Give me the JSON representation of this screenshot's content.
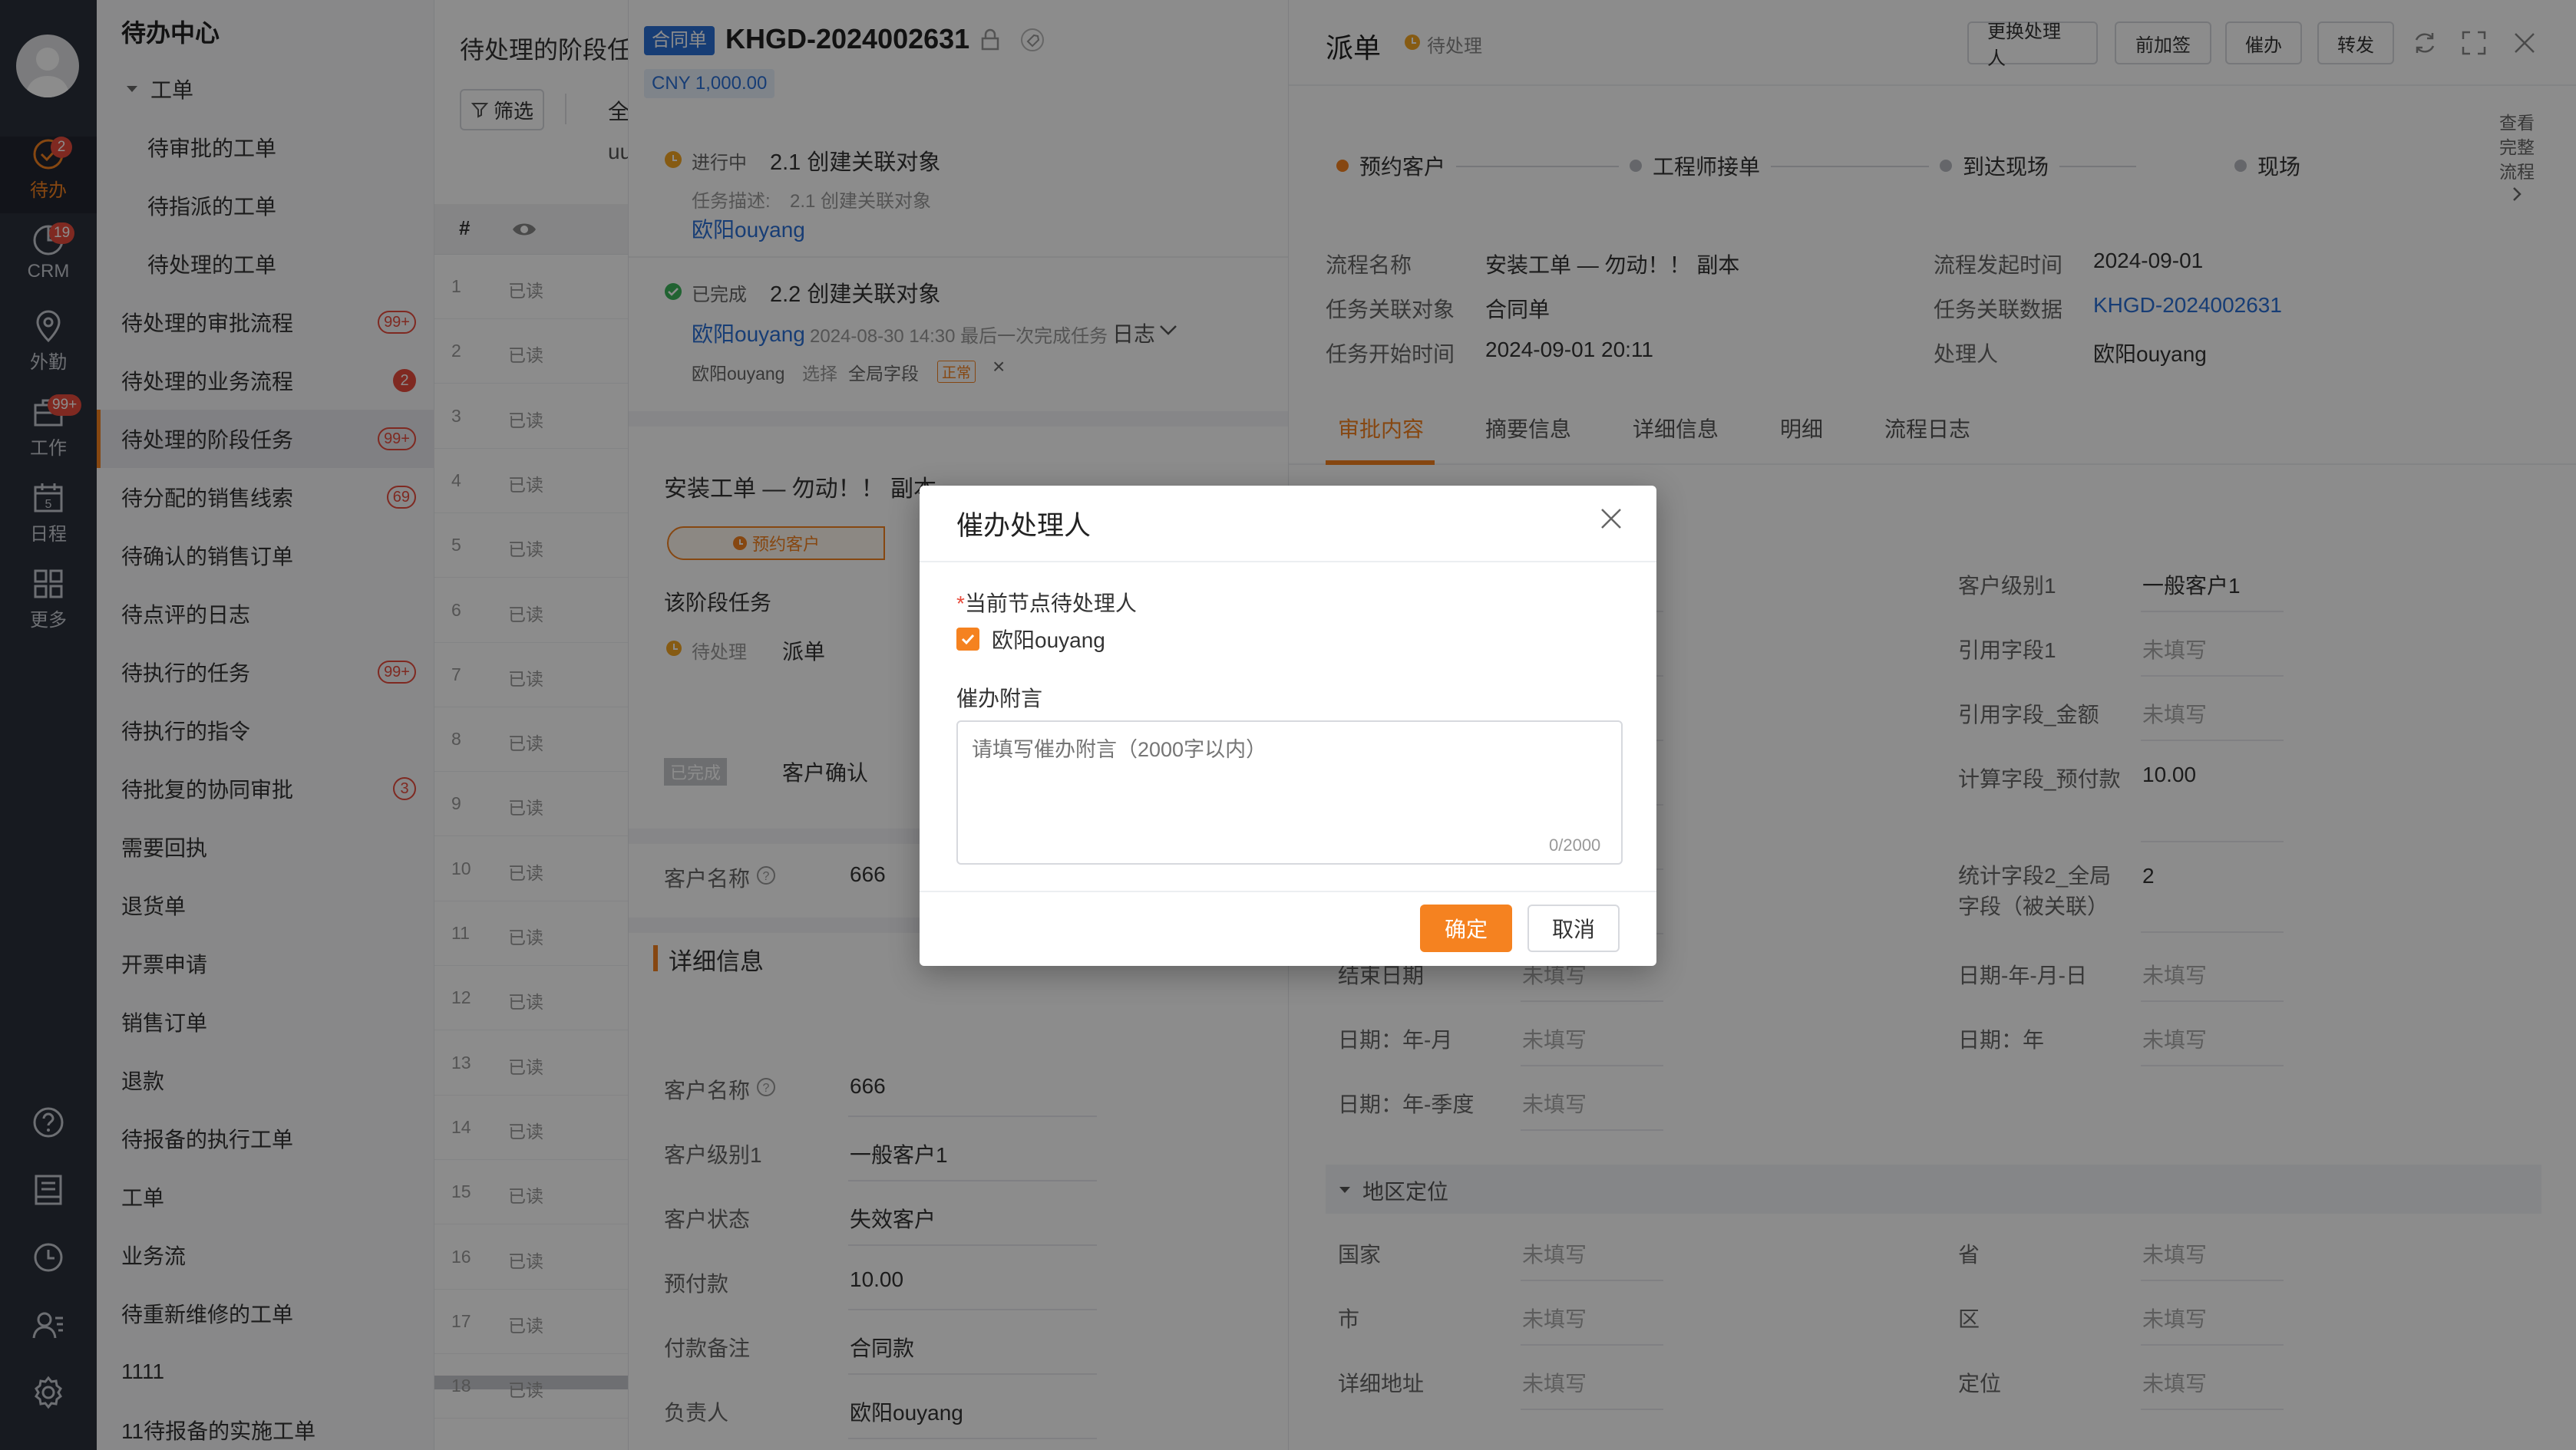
{
  "nav": {
    "items": [
      {
        "label": "待办",
        "badge": "2"
      },
      {
        "label": "CRM",
        "badge": "19"
      },
      {
        "label": "外勤",
        "badge": ""
      },
      {
        "label": "工作",
        "badge": "99+"
      },
      {
        "label": "日程",
        "badge": ""
      },
      {
        "label": "更多",
        "badge": ""
      }
    ],
    "calendar_day": "5"
  },
  "todo": {
    "title": "待办中心",
    "group": "工单",
    "items": [
      {
        "label": "待审批的工单",
        "badge": "",
        "sub": true
      },
      {
        "label": "待指派的工单",
        "badge": "",
        "sub": true
      },
      {
        "label": "待处理的工单",
        "badge": "",
        "sub": true
      },
      {
        "label": "待处理的审批流程",
        "badge": "99+"
      },
      {
        "label": "待处理的业务流程",
        "badge": "2"
      },
      {
        "label": "待处理的阶段任务",
        "badge": "99+",
        "active": true
      },
      {
        "label": "待分配的销售线索",
        "badge": "69"
      },
      {
        "label": "待确认的销售订单",
        "badge": ""
      },
      {
        "label": "待点评的日志",
        "badge": ""
      },
      {
        "label": "待执行的任务",
        "badge": "99+"
      },
      {
        "label": "待执行的指令",
        "badge": ""
      },
      {
        "label": "待批复的协同审批",
        "badge": "3"
      },
      {
        "label": "需要回执",
        "badge": ""
      },
      {
        "label": "退货单",
        "badge": ""
      },
      {
        "label": "开票申请",
        "badge": ""
      },
      {
        "label": "销售订单",
        "badge": ""
      },
      {
        "label": "退款",
        "badge": ""
      },
      {
        "label": "待报备的执行工单",
        "badge": ""
      },
      {
        "label": "工单",
        "badge": ""
      },
      {
        "label": "业务流",
        "badge": ""
      },
      {
        "label": "待重新维修的工单",
        "badge": ""
      },
      {
        "label": "1111",
        "badge": ""
      },
      {
        "label": "11待报备的实施工单",
        "badge": ""
      }
    ]
  },
  "list": {
    "title": "待处理的阶段任",
    "filter": "筛选",
    "tab_partial": "全",
    "user_partial": "uu",
    "col_hash": "#",
    "rows": [
      {
        "n": "1",
        "s": "已读"
      },
      {
        "n": "2",
        "s": "已读"
      },
      {
        "n": "3",
        "s": "已读"
      },
      {
        "n": "4",
        "s": "已读"
      },
      {
        "n": "5",
        "s": "已读"
      },
      {
        "n": "6",
        "s": "已读"
      },
      {
        "n": "7",
        "s": "已读"
      },
      {
        "n": "8",
        "s": "已读"
      },
      {
        "n": "9",
        "s": "已读"
      },
      {
        "n": "10",
        "s": "已读"
      },
      {
        "n": "11",
        "s": "已读"
      },
      {
        "n": "12",
        "s": "已读"
      },
      {
        "n": "13",
        "s": "已读"
      },
      {
        "n": "14",
        "s": "已读"
      },
      {
        "n": "15",
        "s": "已读"
      },
      {
        "n": "16",
        "s": "已读"
      },
      {
        "n": "17",
        "s": "已读"
      },
      {
        "n": "18",
        "s": "已读"
      }
    ]
  },
  "mid": {
    "tag": "合同单",
    "code": "KHGD-2024002631",
    "amount": "CNY 1,000.00",
    "task1": {
      "status": "进行中",
      "title": "2.1 创建关联对象",
      "desc_label": "任务描述:",
      "desc": "2.1 创建关联对象",
      "user": "欧阳ouyang"
    },
    "task2": {
      "status": "已完成",
      "title": "2.2 创建关联对象",
      "user": "欧阳ouyang",
      "meta": "2024-08-30 14:30 最后一次完成任务",
      "log": "日志",
      "line_user": "欧阳ouyang",
      "line_action": "选择",
      "line_field": "全局字段",
      "line_tag": "正常"
    },
    "card_title": "安装工单 — 勿动！！ 副本",
    "stage": "预约客户",
    "stage_task_title": "该阶段任务",
    "st_status": "待处理",
    "st_name": "派单",
    "done_tag": "已完成",
    "done_name": "客户确认",
    "customer_label": "客户名称",
    "customer_val": "666",
    "section": "详细信息",
    "fields": [
      {
        "k": "客户名称",
        "v": "666"
      },
      {
        "k": "客户级别1",
        "v": "一般客户1"
      },
      {
        "k": "客户状态",
        "v": "失效客户"
      },
      {
        "k": "预付款",
        "v": "10.00"
      },
      {
        "k": "付款备注",
        "v": "合同款"
      },
      {
        "k": "负责人",
        "v": "欧阳ouyang"
      }
    ]
  },
  "right": {
    "title": "派单",
    "status": "待处理",
    "buttons": [
      "更换处理人",
      "前加签",
      "催办",
      "转发"
    ],
    "steps": [
      "预约客户",
      "工程师接单",
      "到达现场",
      "现场"
    ],
    "view_flow": [
      "查看",
      "完整",
      "流程"
    ],
    "info": [
      {
        "k": "流程名称",
        "v": "安装工单 — 勿动！！ 副本"
      },
      {
        "k": "流程发起时间",
        "v": "2024-09-01"
      },
      {
        "k": "任务关联对象",
        "v": "合同单"
      },
      {
        "k": "任务关联数据",
        "v": "KHGD-2024002631"
      },
      {
        "k": "任务开始时间",
        "v": "2024-09-01 20:11"
      },
      {
        "k": "处理人",
        "v": "欧阳ouyang"
      }
    ],
    "tabs": [
      "审批内容",
      "摘要信息",
      "详细信息",
      "明细",
      "流程日志"
    ],
    "empty": "未填写",
    "fields_right": [
      {
        "k": "客户级别1",
        "v": "一般客户1"
      },
      {
        "k": "引用字段1",
        "v": "未填写"
      },
      {
        "k": "引用字段_金额",
        "v": "未填写"
      },
      {
        "k": "计算字段_预付款",
        "v": "10.00"
      },
      {
        "k": "统计字段2_全局字段（被关联）",
        "v": "2"
      },
      {
        "k": "日期-年-月-日",
        "v": "未填写"
      },
      {
        "k": "日期：年",
        "v": "未填写"
      }
    ],
    "fields_left": [
      {
        "k": "结束日期",
        "v": "未填写"
      },
      {
        "k": "日期：年-月",
        "v": "未填写"
      },
      {
        "k": "日期：年-季度",
        "v": "未填写"
      }
    ],
    "region_title": "地区定位",
    "region": [
      {
        "k": "国家",
        "v": "未填写"
      },
      {
        "k": "省",
        "v": "未填写"
      },
      {
        "k": "市",
        "v": "未填写"
      },
      {
        "k": "区",
        "v": "未填写"
      },
      {
        "k": "详细地址",
        "v": "未填写"
      },
      {
        "k": "定位",
        "v": "未填写"
      }
    ]
  },
  "modal": {
    "title": "催办处理人",
    "field1": "当前节点待处理人",
    "checked_user": "欧阳ouyang",
    "field2": "催办附言",
    "placeholder": "请填写催办附言（2000字以内）",
    "counter": "0/2000",
    "ok": "确定",
    "cancel": "取消"
  },
  "colors": {
    "accent": "#f58220",
    "nav_bg": "#2b303b",
    "link": "#2a6fd6",
    "badge": "#e84c3d"
  }
}
